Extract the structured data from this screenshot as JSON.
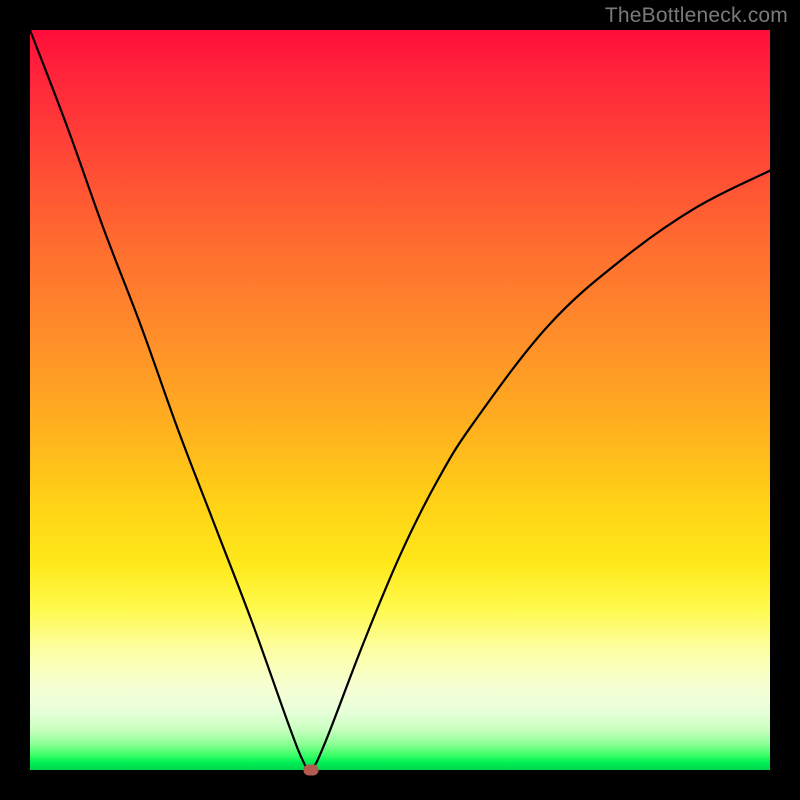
{
  "watermark": "TheBottleneck.com",
  "chart_data": {
    "type": "line",
    "title": "",
    "xlabel": "",
    "ylabel": "",
    "xlim": [
      0,
      100
    ],
    "ylim": [
      0,
      100
    ],
    "grid": false,
    "legend": false,
    "annotations": [],
    "background_gradient": {
      "direction": "vertical",
      "stops": [
        {
          "pos": 0,
          "color": "#ff0d3a"
        },
        {
          "pos": 50,
          "color": "#ffb11e"
        },
        {
          "pos": 78,
          "color": "#fff94a"
        },
        {
          "pos": 95,
          "color": "#8cff95"
        },
        {
          "pos": 100,
          "color": "#00d74b"
        }
      ]
    },
    "series": [
      {
        "name": "bottleneck-curve",
        "x": [
          0,
          5,
          10,
          15,
          20,
          25,
          30,
          35,
          37,
          38,
          40,
          45,
          50,
          55,
          60,
          70,
          80,
          90,
          100
        ],
        "y": [
          100,
          87,
          73,
          60,
          46,
          33,
          20,
          6,
          1,
          0,
          4,
          17,
          29,
          39,
          47,
          60,
          69,
          76,
          81
        ]
      }
    ],
    "marker": {
      "x": 38,
      "y": 0,
      "color": "#b35a4f"
    }
  }
}
